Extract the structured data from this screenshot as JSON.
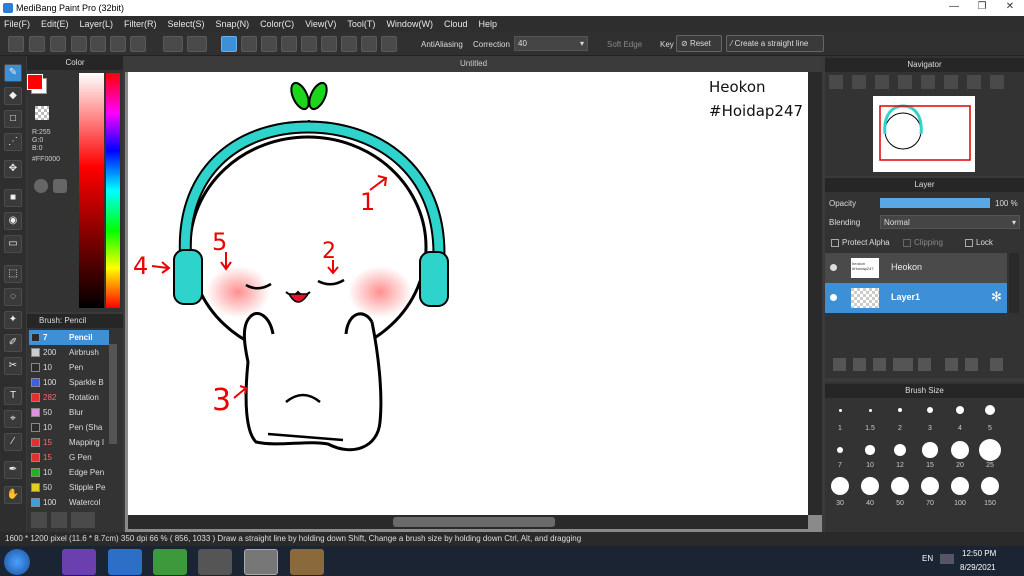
{
  "window": {
    "title": "MediBang Paint Pro (32bit)",
    "minimize": "—",
    "restore": "❐",
    "close": "✕"
  },
  "menu": [
    "File(F)",
    "Edit(E)",
    "Layer(L)",
    "Filter(R)",
    "Select(S)",
    "Snap(N)",
    "Color(C)",
    "View(V)",
    "Tool(T)",
    "Window(W)",
    "Cloud",
    "Help"
  ],
  "toolbar": {
    "antialiasing": "AntiAliasing",
    "correction_label": "Correction",
    "correction_value": "40",
    "soft_edge": "Soft Edge",
    "key_label": "Key",
    "reset": "Reset",
    "straight_line": "Create a straight line"
  },
  "color_panel": {
    "title": "Color",
    "r": "R:255",
    "g": "G:0",
    "b": "B:0",
    "hex": "#FF0000",
    "primary": "#ff0000",
    "secondary": "#ffffff"
  },
  "brush_panel": {
    "title": "Brush: Pencil",
    "items": [
      {
        "size": "7",
        "name": "Pencil",
        "color": "#2b2b2b",
        "selected": true
      },
      {
        "size": "200",
        "name": "Airbrush",
        "color": "#cccccc"
      },
      {
        "size": "10",
        "name": "Pen",
        "color": "#2b2b2b"
      },
      {
        "size": "100",
        "name": "Sparkle B",
        "color": "#3a5fe0"
      },
      {
        "size": "282",
        "name": "Rotation",
        "color": "#e03030"
      },
      {
        "size": "50",
        "name": "Blur",
        "color": "#e090e0"
      },
      {
        "size": "10",
        "name": "Pen (Sha",
        "color": "#2b2b2b"
      },
      {
        "size": "15",
        "name": "Mapping I",
        "color": "#e03030"
      },
      {
        "size": "15",
        "name": "G Pen",
        "color": "#e03030"
      },
      {
        "size": "10",
        "name": "Edge Pen",
        "color": "#20b020"
      },
      {
        "size": "50",
        "name": "Stipple Pe",
        "color": "#e0d020"
      },
      {
        "size": "100",
        "name": "Watercol",
        "color": "#3aa0e0"
      }
    ]
  },
  "document": {
    "title": "Untitled",
    "text_line1": "Heokon",
    "text_line2": "#Hoidap247",
    "marks": [
      "1",
      "2",
      "3",
      "4",
      "5"
    ]
  },
  "navigator": {
    "title": "Navigator"
  },
  "layer_panel": {
    "title": "Layer",
    "opacity_label": "Opacity",
    "opacity_value": "100 %",
    "opacity_fraction": 1.0,
    "blending_label": "Blending",
    "blending_value": "Normal",
    "protect_alpha": "Protect Alpha",
    "clipping": "Clipping",
    "lock": "Lock",
    "layers": [
      {
        "name": "Heokon",
        "selected": false,
        "thumb_line1": "heokon",
        "thumb_line2": "#Hoidap247"
      },
      {
        "name": "Layer1",
        "selected": true
      }
    ]
  },
  "brush_size": {
    "title": "Brush Size",
    "sizes": [
      "1",
      "1.5",
      "2",
      "3",
      "4",
      "5",
      "7",
      "10",
      "12",
      "15",
      "20",
      "25",
      "30",
      "40",
      "50",
      "70",
      "100",
      "150"
    ]
  },
  "status": {
    "text": "1600 * 1200 pixel   (11.6 * 8.7cm)   350 dpi   66 %   ( 856, 1033 )   Draw a straight line by holding down Shift, Change a brush size by holding down Ctrl, Alt, and dragging"
  },
  "taskbar": {
    "lang": "EN",
    "time": "12:50 PM",
    "date": "8/29/2021"
  }
}
